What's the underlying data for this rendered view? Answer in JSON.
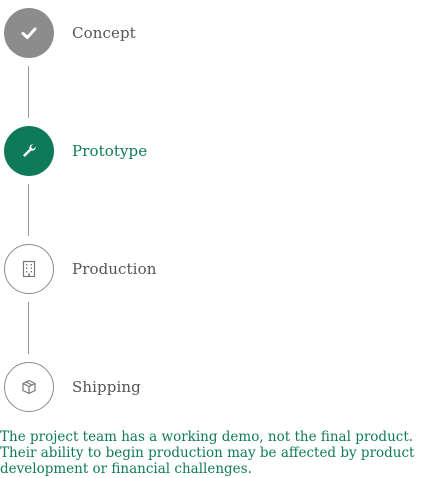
{
  "steps": [
    {
      "label": "Concept",
      "status": "complete",
      "icon": "checkmark-icon"
    },
    {
      "label": "Prototype",
      "status": "current",
      "icon": "wrench-icon"
    },
    {
      "label": "Production",
      "status": "upcoming",
      "icon": "building-icon"
    },
    {
      "label": "Shipping",
      "status": "upcoming",
      "icon": "box-icon"
    }
  ],
  "description": "The project team has a working demo, not the final product. Their ability to begin production may be affected by product development or financial challenges.",
  "colors": {
    "complete": "#8c8c8c",
    "current": "#0f7a5a",
    "upcoming_border": "#8c8c8c",
    "label": "#555555",
    "connector": "#9a9a9a"
  }
}
